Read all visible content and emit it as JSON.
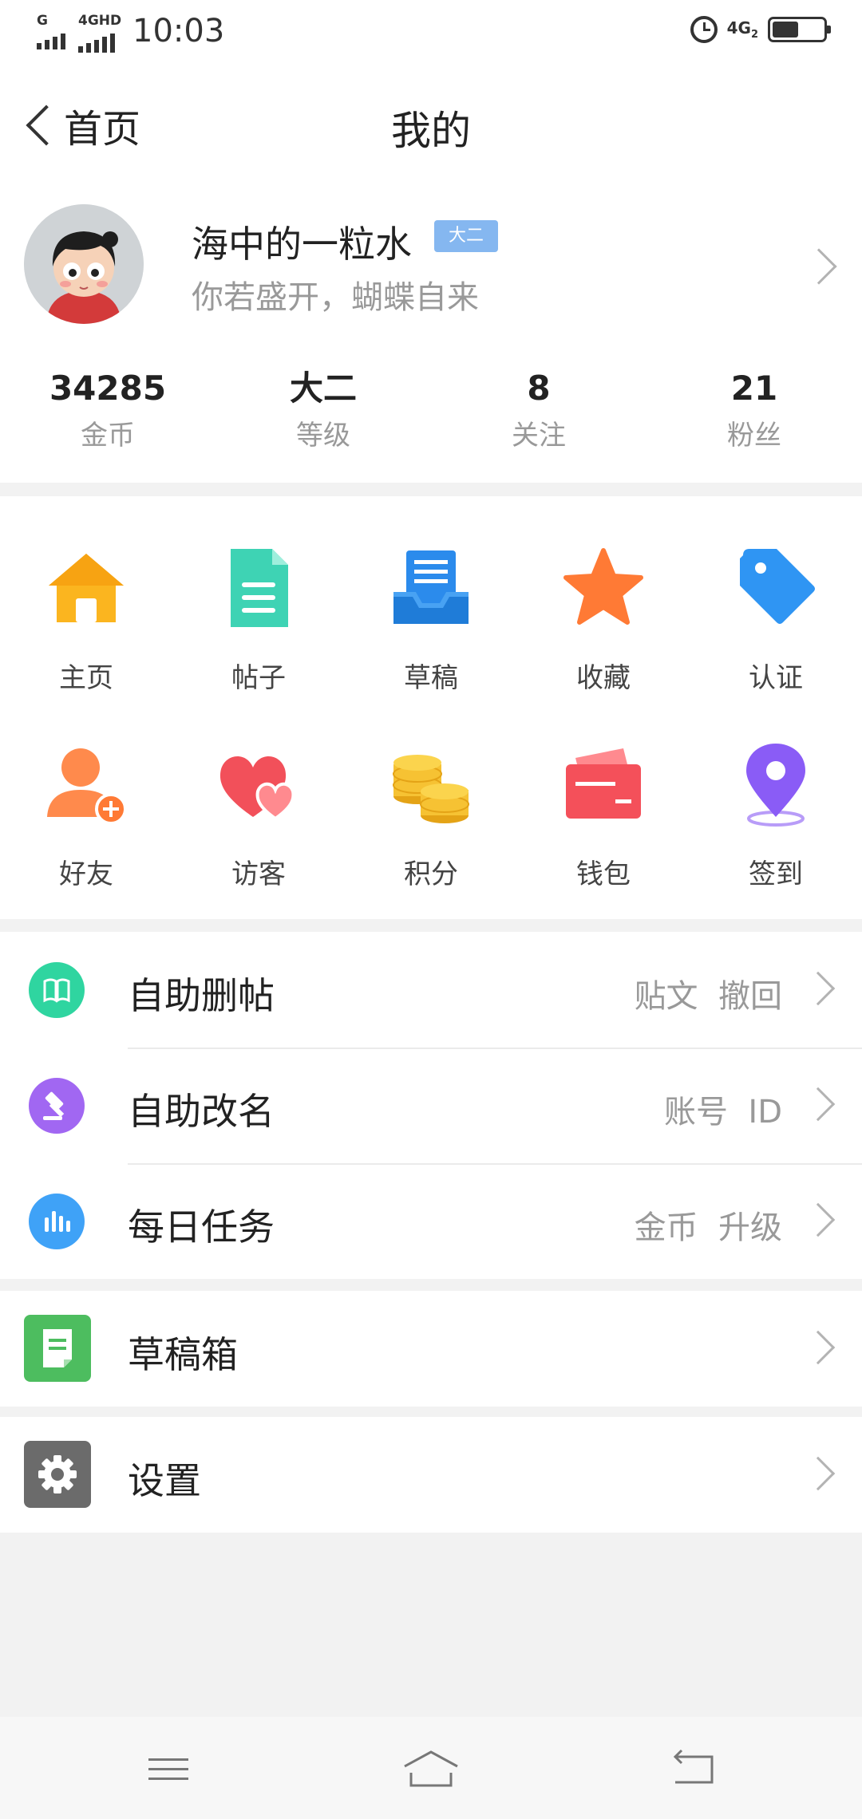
{
  "status_bar": {
    "signal1_tag": "G",
    "signal2_tag": "4GHD",
    "time": "10:03",
    "network": "4G",
    "network_sub": "2",
    "battery_level": 0.52
  },
  "header": {
    "back_label": "首页",
    "title": "我的"
  },
  "profile": {
    "username": "海中的一粒水",
    "level_badge": "大二",
    "signature": "你若盛开，蝴蝶自来"
  },
  "stats": [
    {
      "value": "34285",
      "label": "金币"
    },
    {
      "value": "大二",
      "label": "等级"
    },
    {
      "value": "8",
      "label": "关注"
    },
    {
      "value": "21",
      "label": "粉丝"
    }
  ],
  "grid": [
    {
      "label": "主页",
      "icon": "home-icon",
      "color": "#fbb51f"
    },
    {
      "label": "帖子",
      "icon": "post-document-icon",
      "color": "#3ed3b4"
    },
    {
      "label": "草稿",
      "icon": "draft-tray-icon",
      "color": "#2b8bec"
    },
    {
      "label": "收藏",
      "icon": "star-icon",
      "color": "#ff7a35"
    },
    {
      "label": "认证",
      "icon": "tag-icon",
      "color": "#2f95f3"
    },
    {
      "label": "好友",
      "icon": "add-friend-icon",
      "color": "#ff8a4c"
    },
    {
      "label": "访客",
      "icon": "visitor-hearts-icon",
      "color": "#f2505a"
    },
    {
      "label": "积分",
      "icon": "coins-icon",
      "color": "#f6c233"
    },
    {
      "label": "钱包",
      "icon": "wallet-card-icon",
      "color": "#f4505a"
    },
    {
      "label": "签到",
      "icon": "location-pin-icon",
      "color": "#8a5cf6"
    }
  ],
  "list1": [
    {
      "title": "自助删帖",
      "extra": "贴文  撤回",
      "icon": "book-icon",
      "color": "#2fd5a0"
    },
    {
      "title": "自助改名",
      "extra": "账号  ID",
      "icon": "gavel-icon",
      "color": "#a167f2"
    },
    {
      "title": "每日任务",
      "extra": "金币  升级",
      "icon": "bar-chart-icon",
      "color": "#3fa2f7"
    }
  ],
  "list2": {
    "title": "草稿箱",
    "icon": "draft-box-icon",
    "color": "#4dbd5f"
  },
  "list3": {
    "title": "设置",
    "icon": "gear-icon",
    "color": "#6b6b6b"
  }
}
